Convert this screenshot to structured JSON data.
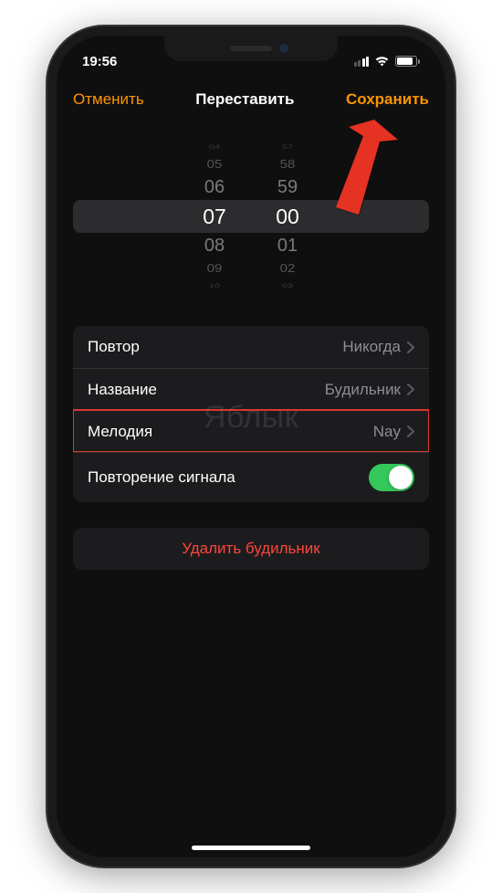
{
  "status": {
    "time": "19:56"
  },
  "nav": {
    "cancel": "Отменить",
    "title": "Переставить",
    "save": "Сохранить"
  },
  "picker": {
    "hours": {
      "m3": "04",
      "m2": "05",
      "m1": "06",
      "sel": "07",
      "p1": "08",
      "p2": "09",
      "p3": "10"
    },
    "minutes": {
      "m3": "57",
      "m2": "58",
      "m1": "59",
      "sel": "00",
      "p1": "01",
      "p2": "02",
      "p3": "03"
    }
  },
  "rows": {
    "repeat": {
      "label": "Повтор",
      "value": "Никогда"
    },
    "name": {
      "label": "Название",
      "value": "Будильник"
    },
    "sound": {
      "label": "Мелодия",
      "value": "Nay"
    },
    "snooze": {
      "label": "Повторение сигнала"
    }
  },
  "delete": {
    "label": "Удалить будильник"
  },
  "watermark": "Яблык"
}
